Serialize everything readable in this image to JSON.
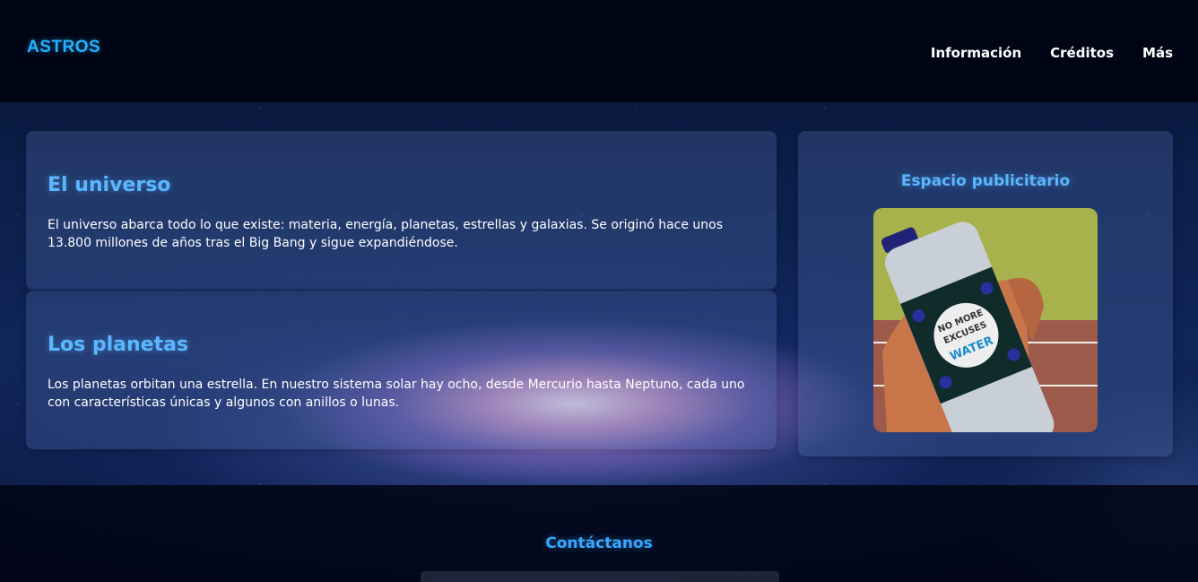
{
  "header": {
    "logo": "ASTROS",
    "nav": [
      "Información",
      "Créditos",
      "Más"
    ]
  },
  "sections": [
    {
      "title": "El universo",
      "text": "El universo abarca todo lo que existe: materia, energía, planetas, estrellas y galaxias. Se originó hace unos 13.800 millones de años tras el Big Bang y sigue expandiéndose."
    },
    {
      "title": "Los planetas",
      "text": "Los planetas orbitan una estrella. En nuestro sistema solar hay ocho, desde Mercurio hasta Neptuno, cada uno con características únicas y algunos con anillos o lunas."
    }
  ],
  "ad": {
    "title": "Espacio publicitario",
    "image_text": [
      "NO MORE",
      "EXCUSES",
      "WATER"
    ]
  },
  "footer": {
    "title": "Contáctanos"
  },
  "colors": {
    "accent": "#25b2ff",
    "heading": "#5ab7ff"
  }
}
